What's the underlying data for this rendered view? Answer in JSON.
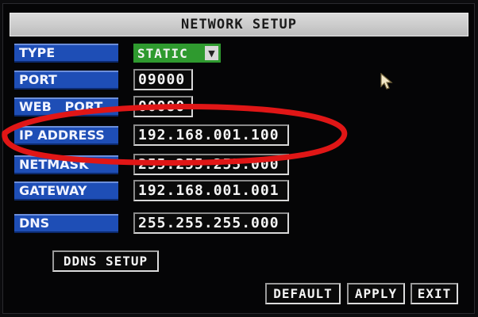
{
  "window": {
    "title": "NETWORK SETUP"
  },
  "fields": [
    {
      "label": "TYPE",
      "value": "STATIC",
      "control": "dropdown"
    },
    {
      "label": "PORT",
      "value": "09000"
    },
    {
      "label": "WEB   PORT",
      "value": "00080"
    },
    {
      "label": "IP ADDRESS",
      "value": "192.168.001.100"
    },
    {
      "label": "NETMASK",
      "value": "255.255.255.000"
    },
    {
      "label": "GATEWAY",
      "value": "192.168.001.001"
    },
    {
      "label": "DNS",
      "value": "255.255.255.000"
    }
  ],
  "buttons": {
    "ddns_setup": "DDNS SETUP",
    "default": "DEFAULT",
    "apply": "APPLY",
    "exit": "EXIT"
  },
  "colors": {
    "label_background": "#1e4eb6",
    "dropdown_background": "#2f9a2f",
    "annotation_ellipse": "#e01616",
    "screen_background": "#050506"
  },
  "annotation": {
    "type": "red-ellipse",
    "highlights": "IP ADDRESS"
  },
  "icons": {
    "dropdown": "chevron-down-icon",
    "pointer": "mouse-pointer-icon"
  }
}
